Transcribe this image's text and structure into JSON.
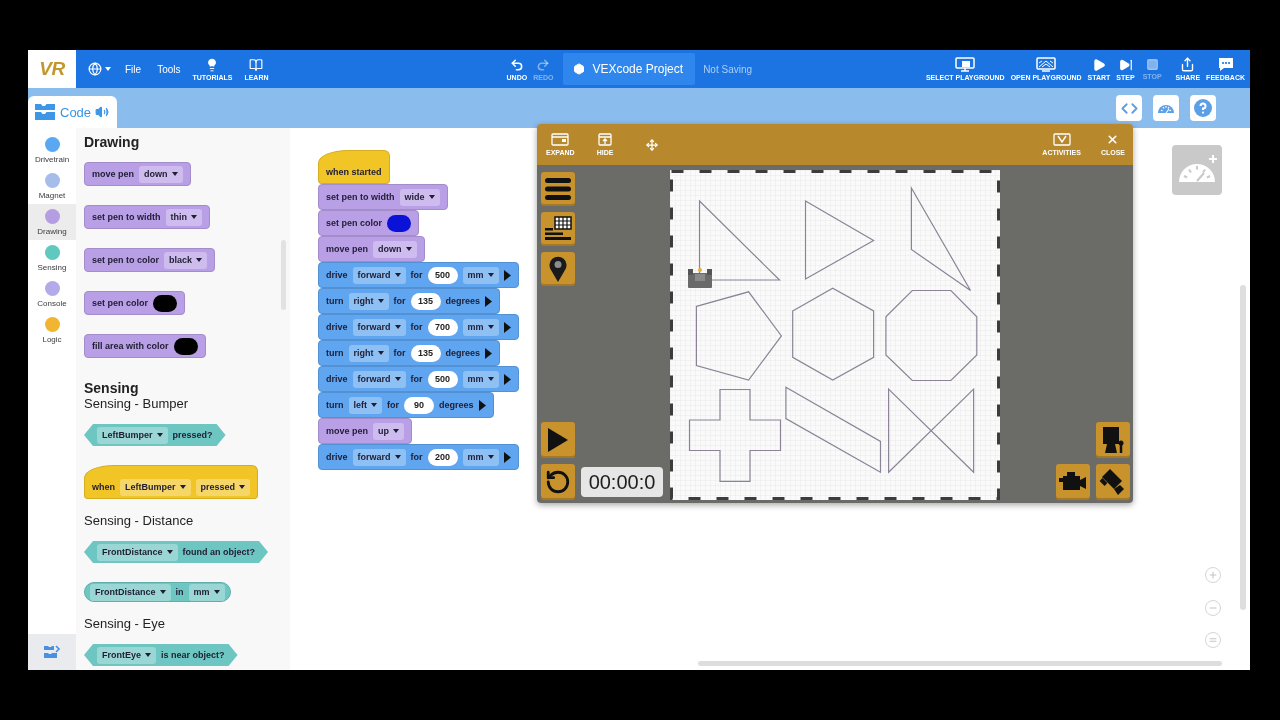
{
  "top_bar": {
    "logo": "VR",
    "menus": [
      "File",
      "Tools"
    ],
    "learning": [
      {
        "kind": "tutorials",
        "label": "TUTORIALS"
      },
      {
        "kind": "learn",
        "label": "LEARN"
      }
    ],
    "history": [
      {
        "kind": "undo",
        "label": "UNDO",
        "disabled": false
      },
      {
        "kind": "redo",
        "label": "REDO",
        "disabled": true
      }
    ],
    "project_name": "VEXcode Project",
    "save_status": "Not Saving",
    "actions": [
      {
        "kind": "select-playground",
        "label": "SELECT PLAYGROUND",
        "disabled": false
      },
      {
        "kind": "open-playground",
        "label": "OPEN PLAYGROUND",
        "disabled": false
      },
      {
        "kind": "start",
        "label": "START",
        "disabled": false
      },
      {
        "kind": "step",
        "label": "STEP",
        "disabled": false
      },
      {
        "kind": "stop",
        "label": "STOP",
        "disabled": true
      },
      {
        "kind": "share",
        "label": "SHARE",
        "disabled": false
      },
      {
        "kind": "feedback",
        "label": "FEEDBACK",
        "disabled": false
      }
    ]
  },
  "tabs": [
    {
      "label": "Code",
      "selected": true
    }
  ],
  "categories": [
    {
      "name": "Drivetrain",
      "color": "#5aa7f2",
      "selected": false
    },
    {
      "name": "Magnet",
      "color": "#a6bce9",
      "selected": false
    },
    {
      "name": "Drawing",
      "color": "#b59de1",
      "selected": true
    },
    {
      "name": "Sensing",
      "color": "#5fc8bf",
      "selected": false
    },
    {
      "name": "Console",
      "color": "#b3abe9",
      "selected": false
    },
    {
      "name": "Logic",
      "color": "#f1b531",
      "selected": false
    }
  ],
  "palette": {
    "items": [
      {
        "kind": "heading",
        "text": "Drawing"
      },
      {
        "kind": "stack",
        "color": "#b99fe6",
        "parts": [
          {
            "kind": "text",
            "text": "move pen"
          },
          {
            "kind": "dropdown",
            "text": "down"
          }
        ]
      },
      {
        "kind": "stack",
        "color": "#b99fe6",
        "parts": [
          {
            "kind": "text",
            "text": "set pen to width"
          },
          {
            "kind": "dropdown",
            "text": "thin"
          }
        ]
      },
      {
        "kind": "stack",
        "color": "#b99fe6",
        "parts": [
          {
            "kind": "text",
            "text": "set pen to color"
          },
          {
            "kind": "dropdown",
            "text": "black"
          }
        ]
      },
      {
        "kind": "stack",
        "color": "#b99fe6",
        "parts": [
          {
            "kind": "text",
            "text": "set pen color"
          },
          {
            "kind": "swatch",
            "color": "#000000"
          }
        ]
      },
      {
        "kind": "stack",
        "color": "#b99fe6",
        "parts": [
          {
            "kind": "text",
            "text": "fill area with color"
          },
          {
            "kind": "swatch",
            "color": "#000000"
          }
        ]
      },
      {
        "kind": "heading",
        "text": "Sensing"
      },
      {
        "kind": "subheading",
        "text": "Sensing - Bumper"
      },
      {
        "kind": "boolean",
        "color": "#6ec6c2",
        "parts": [
          {
            "kind": "dropdown",
            "text": "LeftBumper"
          },
          {
            "kind": "text",
            "text": "pressed?"
          }
        ]
      },
      {
        "kind": "hat",
        "color": "#f2c526",
        "parts": [
          {
            "kind": "text",
            "text": "when"
          },
          {
            "kind": "dropdown",
            "text": "LeftBumper"
          },
          {
            "kind": "dropdown",
            "text": "pressed"
          }
        ]
      },
      {
        "kind": "subheading",
        "text": "Sensing - Distance"
      },
      {
        "kind": "boolean",
        "color": "#6ec6c2",
        "parts": [
          {
            "kind": "dropdown",
            "text": "FrontDistance"
          },
          {
            "kind": "text",
            "text": "found an object?"
          }
        ]
      },
      {
        "kind": "reporter",
        "color": "#6ec6c2",
        "parts": [
          {
            "kind": "dropdown",
            "text": "FrontDistance"
          },
          {
            "kind": "text",
            "text": "in"
          },
          {
            "kind": "dropdown",
            "text": "mm"
          }
        ]
      },
      {
        "kind": "subheading",
        "text": "Sensing - Eye"
      },
      {
        "kind": "boolean",
        "color": "#6ec6c2",
        "parts": [
          {
            "kind": "dropdown",
            "text": "FrontEye"
          },
          {
            "kind": "text",
            "text": "is near object?"
          }
        ]
      }
    ]
  },
  "script": {
    "blocks": [
      {
        "kind": "hat",
        "color": "#f2c526",
        "parts": [
          {
            "kind": "text",
            "text": "when started"
          }
        ]
      },
      {
        "kind": "stack",
        "color": "#b99fe6",
        "parts": [
          {
            "kind": "text",
            "text": "set pen to width"
          },
          {
            "kind": "dropdown",
            "text": "wide"
          }
        ]
      },
      {
        "kind": "stack",
        "color": "#b99fe6",
        "parts": [
          {
            "kind": "text",
            "text": "set pen color"
          },
          {
            "kind": "swatch",
            "color": "#0a12d8"
          }
        ]
      },
      {
        "kind": "stack",
        "color": "#b99fe6",
        "parts": [
          {
            "kind": "text",
            "text": "move pen"
          },
          {
            "kind": "dropdown",
            "text": "down"
          }
        ]
      },
      {
        "kind": "stack",
        "color": "#5fa5ef",
        "parts": [
          {
            "kind": "text",
            "text": "drive"
          },
          {
            "kind": "dropdown",
            "text": "forward"
          },
          {
            "kind": "text",
            "text": "for"
          },
          {
            "kind": "number",
            "text": "500"
          },
          {
            "kind": "dropdown",
            "text": "mm"
          },
          {
            "kind": "arrow"
          }
        ]
      },
      {
        "kind": "stack",
        "color": "#5fa5ef",
        "parts": [
          {
            "kind": "text",
            "text": "turn"
          },
          {
            "kind": "dropdown",
            "text": "right"
          },
          {
            "kind": "text",
            "text": "for"
          },
          {
            "kind": "number",
            "text": "135"
          },
          {
            "kind": "text",
            "text": "degrees"
          },
          {
            "kind": "arrow"
          }
        ]
      },
      {
        "kind": "stack",
        "color": "#5fa5ef",
        "parts": [
          {
            "kind": "text",
            "text": "drive"
          },
          {
            "kind": "dropdown",
            "text": "forward"
          },
          {
            "kind": "text",
            "text": "for"
          },
          {
            "kind": "number",
            "text": "700"
          },
          {
            "kind": "dropdown",
            "text": "mm"
          },
          {
            "kind": "arrow"
          }
        ]
      },
      {
        "kind": "stack",
        "color": "#5fa5ef",
        "parts": [
          {
            "kind": "text",
            "text": "turn"
          },
          {
            "kind": "dropdown",
            "text": "right"
          },
          {
            "kind": "text",
            "text": "for"
          },
          {
            "kind": "number",
            "text": "135"
          },
          {
            "kind": "text",
            "text": "degrees"
          },
          {
            "kind": "arrow"
          }
        ]
      },
      {
        "kind": "stack",
        "color": "#5fa5ef",
        "parts": [
          {
            "kind": "text",
            "text": "drive"
          },
          {
            "kind": "dropdown",
            "text": "forward"
          },
          {
            "kind": "text",
            "text": "for"
          },
          {
            "kind": "number",
            "text": "500"
          },
          {
            "kind": "dropdown",
            "text": "mm"
          },
          {
            "kind": "arrow"
          }
        ]
      },
      {
        "kind": "stack",
        "color": "#5fa5ef",
        "parts": [
          {
            "kind": "text",
            "text": "turn"
          },
          {
            "kind": "dropdown",
            "text": "left"
          },
          {
            "kind": "text",
            "text": "for"
          },
          {
            "kind": "number",
            "text": "90"
          },
          {
            "kind": "text",
            "text": "degrees"
          },
          {
            "kind": "arrow"
          }
        ]
      },
      {
        "kind": "stack",
        "color": "#b99fe6",
        "parts": [
          {
            "kind": "text",
            "text": "move pen"
          },
          {
            "kind": "dropdown",
            "text": "up"
          }
        ]
      },
      {
        "kind": "stack",
        "color": "#5fa5ef",
        "parts": [
          {
            "kind": "text",
            "text": "drive"
          },
          {
            "kind": "dropdown",
            "text": "forward"
          },
          {
            "kind": "text",
            "text": "for"
          },
          {
            "kind": "number",
            "text": "200"
          },
          {
            "kind": "dropdown",
            "text": "mm"
          },
          {
            "kind": "arrow"
          }
        ]
      }
    ]
  },
  "playground": {
    "header_left": [
      {
        "kind": "expand",
        "label": "EXPAND"
      },
      {
        "kind": "hide",
        "label": "HIDE"
      }
    ],
    "header_right": [
      {
        "kind": "activities",
        "label": "ACTIVITIES"
      },
      {
        "kind": "close",
        "label": "CLOSE"
      }
    ],
    "timer": "00:00:0"
  }
}
